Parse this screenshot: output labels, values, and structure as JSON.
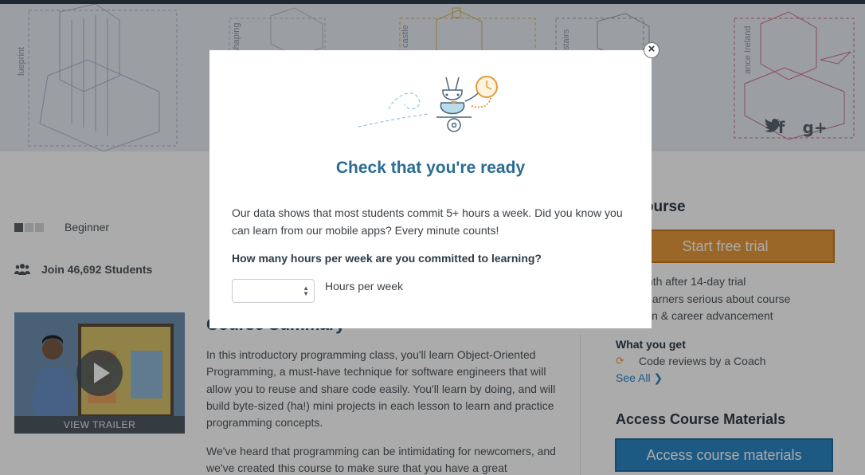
{
  "banner": {
    "labels": [
      "lueprint",
      "shaping",
      "castle",
      "stairs",
      "ance Ireland"
    ],
    "social": [
      "f",
      "g+",
      "twitter-icon"
    ]
  },
  "meta": {
    "level": "Beginner",
    "students": "Join 46,692 Students"
  },
  "trailer": {
    "label": "VIEW TRAILER"
  },
  "summary": {
    "title": "Course Summary",
    "paragraphs": [
      "In this introductory programming class, you'll learn Object-Oriented Programming, a must-have technique for software engineers that will allow you to reuse and share code easily. You'll learn by doing, and will build byte-sized (ha!) mini projects in each lesson to learn and practice programming concepts.",
      "We've heard that programming can be intimidating for newcomers, and we've created this course to make sure that you have a great"
    ]
  },
  "sidebar": {
    "enroll_title": "in Course",
    "trial_button": "Start free trial",
    "price_lines": [
      "99/month after 14-day trial",
      "st for learners serious about course",
      "mpletion & career advancement"
    ],
    "what_you_get": "What you get",
    "get_item": "Code reviews by a Coach",
    "see_all": "See All ❯",
    "access_title": "Access Course Materials",
    "access_button": "Access course materials"
  },
  "modal": {
    "title": "Check that you're ready",
    "text": "Our data shows that most students commit 5+ hours a week. Did you know you can learn from our mobile apps? Every minute counts!",
    "question": "How many hours per week are you committed to learning?",
    "select_value": "",
    "hours_label": "Hours per week",
    "close": "×"
  },
  "colors": {
    "accent_blue": "#2b86c5",
    "trial_orange": "#e69a3c",
    "modal_title": "#2a6c94"
  }
}
